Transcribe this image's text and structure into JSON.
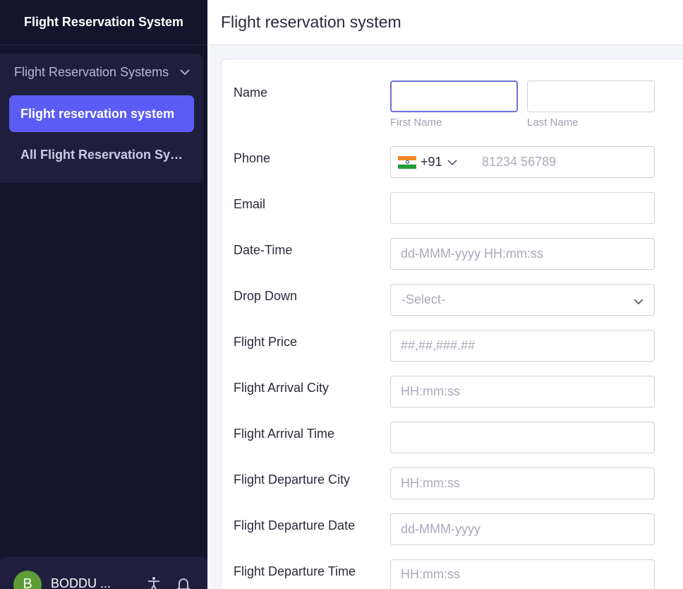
{
  "sidebar": {
    "title": "Flight Reservation System",
    "group_label": "Flight Reservation Systems",
    "items": [
      {
        "label": "Flight reservation system",
        "active": true
      },
      {
        "label": "All Flight Reservation Syst..."
      }
    ],
    "user": {
      "initial": "B",
      "name": "BODDU ..."
    }
  },
  "header": {
    "title": "Flight reservation system"
  },
  "form": {
    "name": {
      "label": "Name",
      "first_hint": "First Name",
      "last_hint": "Last Name",
      "first_value": "",
      "last_value": ""
    },
    "phone": {
      "label": "Phone",
      "country_code": "+91",
      "placeholder": "81234 56789"
    },
    "email": {
      "label": "Email",
      "placeholder": ""
    },
    "datetime": {
      "label": "Date-Time",
      "placeholder": "dd-MMM-yyyy HH:mm:ss"
    },
    "dropdown": {
      "label": "Drop Down",
      "selected": "-Select-"
    },
    "price": {
      "label": "Flight Price",
      "placeholder": "##,##,###.##"
    },
    "arrival_city": {
      "label": "Flight Arrival City",
      "placeholder": "HH:mm:ss"
    },
    "arrival_time": {
      "label": "Flight Arrival Time",
      "placeholder": ""
    },
    "departure_city": {
      "label": "Flight Departure City",
      "placeholder": "HH:mm:ss"
    },
    "departure_date": {
      "label": "Flight Departure Date",
      "placeholder": "dd-MMM-yyyy"
    },
    "departure_time": {
      "label": "Flight Departure Time",
      "placeholder": "HH:mm:ss"
    }
  },
  "colors": {
    "sidebar_bg": "#14142c",
    "active_item": "#5b5cf6",
    "avatar": "#5c9e34",
    "focus_border": "#6e6fd6"
  }
}
